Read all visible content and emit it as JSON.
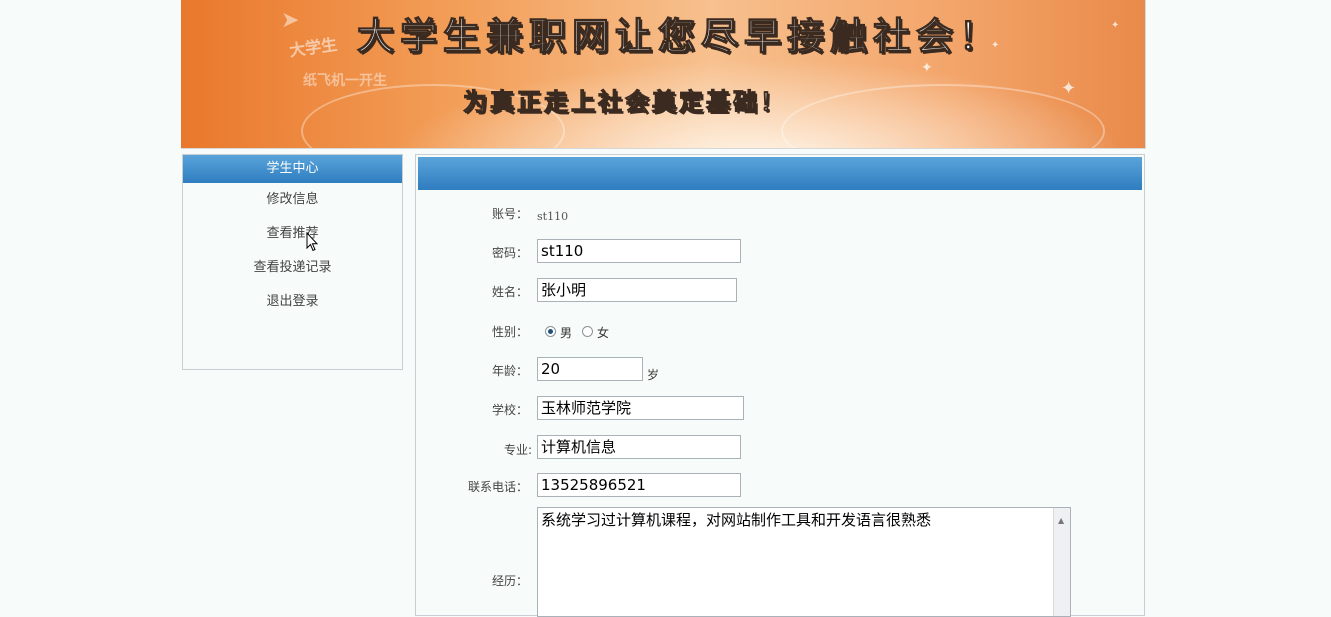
{
  "banner": {
    "title": "大学生兼职网让您尽早接触社会！",
    "subtitle": "为真正走上社会奠定基础！",
    "ghost_text_1": "大学生",
    "ghost_text_2": "纸飞机一开生"
  },
  "sidebar": {
    "header": "学生中心",
    "items": [
      {
        "label": "修改信息"
      },
      {
        "label": "查看推荐"
      },
      {
        "label": "查看投递记录"
      },
      {
        "label": "退出登录"
      }
    ]
  },
  "form": {
    "account_label": "账号：",
    "account_value": "st110",
    "password_label": "密码：",
    "password_value": "st110",
    "name_label": "姓名：",
    "name_value": "张小明",
    "gender_label": "性别：",
    "gender_options": [
      "男",
      "女"
    ],
    "gender_selected": "男",
    "age_label": "年龄：",
    "age_value": "20",
    "age_unit": "岁",
    "school_label": "学校：",
    "school_value": "玉林师范学院",
    "major_label": "专业:",
    "major_value": "计算机信息",
    "phone_label": "联系电话：",
    "phone_value": "13525896521",
    "experience_label": "经历：",
    "experience_value": "系统学习过计算机课程，对网站制作工具和开发语言很熟悉"
  },
  "colors": {
    "header_blue": "#2f7dc0",
    "banner_orange": "#f3a05b"
  }
}
